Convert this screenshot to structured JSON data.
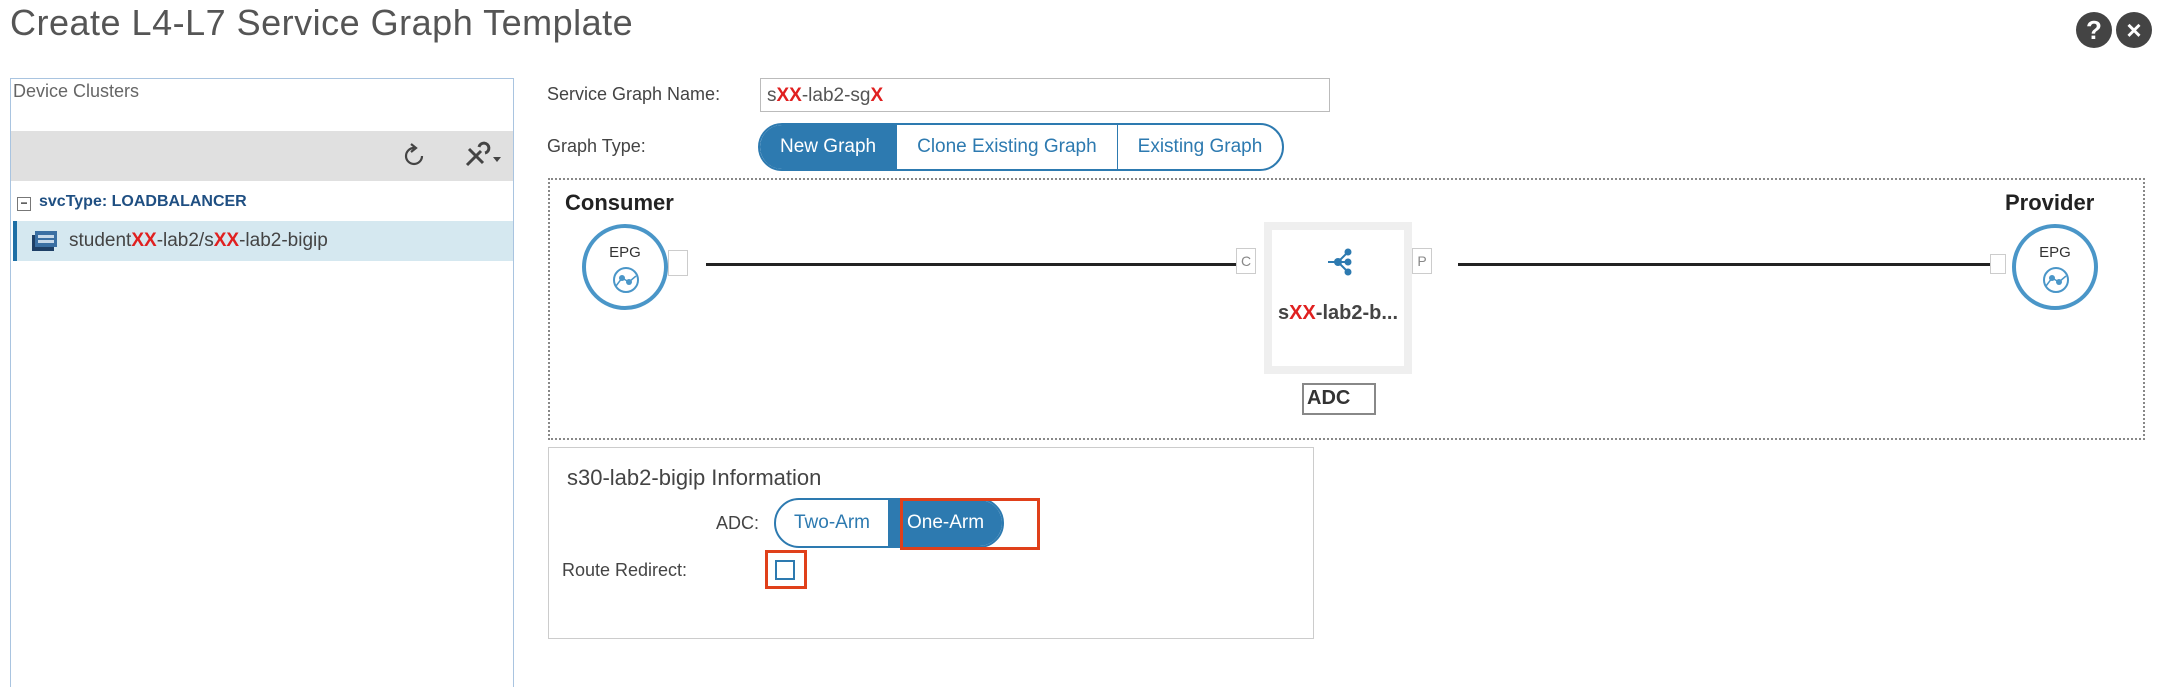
{
  "dialog": {
    "title": "Create L4-L7 Service Graph Template",
    "help_icon": "help-icon",
    "close_icon": "close-icon"
  },
  "left_panel": {
    "title": "Device Clusters",
    "toolbar": {
      "refresh_icon": "refresh-icon",
      "tools_icon": "tools-dropdown-icon"
    },
    "group": {
      "toggle": "−",
      "label": "svcType: LOADBALANCER"
    },
    "cluster": {
      "prefix": "student",
      "redx1": "XX",
      "mid": "-lab2/s",
      "redx2": "XX",
      "suffix": "-lab2-bigip"
    }
  },
  "form": {
    "name_label": "Service Graph Name:",
    "name_value": {
      "prefix": "s",
      "redx1": "XX",
      "mid": "-lab2-sg",
      "redx2": "X"
    },
    "type_label": "Graph Type:",
    "graph_types": [
      "New Graph",
      "Clone Existing Graph",
      "Existing Graph"
    ],
    "graph_type_selected": "New Graph"
  },
  "canvas": {
    "consumer_label": "Consumer",
    "provider_label": "Provider",
    "epg_label": "EPG",
    "port_c": "C",
    "port_p": "P",
    "node": {
      "prefix": "s",
      "redx": "XX",
      "suffix": "-lab2-b...",
      "icon": "service-node-icon"
    },
    "node_function_value": "ADC"
  },
  "info": {
    "title": "s30-lab2-bigip Information",
    "adc_label": "ADC:",
    "adc_options": [
      "Two-Arm",
      "One-Arm"
    ],
    "adc_selected": "One-Arm",
    "route_redirect_label": "Route Redirect:",
    "route_redirect_checked": false
  },
  "colors": {
    "accent": "#2d7ab0",
    "highlight": "#e0401a",
    "selection_row": "#d5e8f0"
  }
}
